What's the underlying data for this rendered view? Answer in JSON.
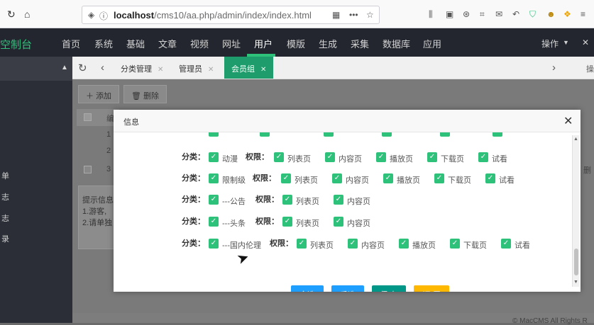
{
  "browser": {
    "url_host": "localhost",
    "url_path": "/cms10/aa.php/admin/index/index.html"
  },
  "header": {
    "logo": "空制台",
    "nav": [
      "首页",
      "系统",
      "基础",
      "文章",
      "视频",
      "网址",
      "用户",
      "模版",
      "生成",
      "采集",
      "数据库",
      "应用"
    ],
    "active_nav": "用户",
    "right_menu": "操作",
    "accent_color": "#2ec17a"
  },
  "sidebar": {
    "items": [
      "单",
      "志",
      "志",
      "录"
    ]
  },
  "tabs": [
    {
      "label": "分类管理"
    },
    {
      "label": "管理员"
    },
    {
      "label": "会员组",
      "active": true
    }
  ],
  "tab_right_text": "操",
  "toolbar": {
    "add_label": "添加",
    "delete_label": "删除"
  },
  "background_table": {
    "header": "编",
    "rows": [
      "1",
      "2",
      "3"
    ],
    "right_text": "删"
  },
  "tip": {
    "lines": [
      "提示信息",
      "1.游客,",
      "2.请单独"
    ]
  },
  "footer": "© MacCMS All Rights R",
  "modal": {
    "title": "信息",
    "category_label": "分类：",
    "permission_label": "权限：",
    "rows": [
      {
        "category": "动漫",
        "permissions": [
          "列表页",
          "内容页",
          "播放页",
          "下载页",
          "试看"
        ]
      },
      {
        "category": "限制级",
        "permissions": [
          "列表页",
          "内容页",
          "播放页",
          "下载页",
          "试看"
        ]
      },
      {
        "category": "---公告",
        "permissions": [
          "列表页",
          "内容页"
        ]
      },
      {
        "category": "---头条",
        "permissions": [
          "列表页",
          "内容页"
        ]
      },
      {
        "category": "---国内伦理",
        "permissions": [
          "列表页",
          "内容页",
          "播放页",
          "下载页",
          "试看"
        ]
      }
    ],
    "buttons": {
      "select_all": "全选",
      "invert": "反选",
      "save": "保 存",
      "reset": "还 原"
    },
    "button_colors": {
      "select_all": "#1e9fff",
      "invert": "#1e9fff",
      "save": "#009688",
      "reset": "#ffb800"
    }
  }
}
